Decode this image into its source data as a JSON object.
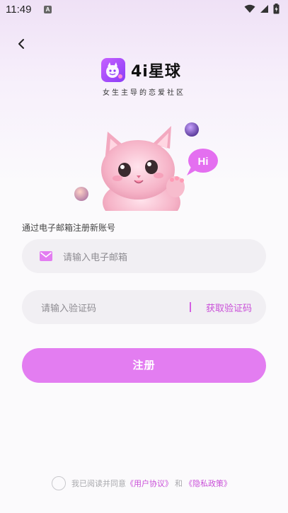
{
  "status_bar": {
    "time": "11:49",
    "app_icon_letter": "A",
    "icons": [
      "wifi-icon",
      "signal-icon",
      "battery-icon"
    ]
  },
  "header": {
    "back_icon": "back-arrow-icon"
  },
  "logo": {
    "text": "4i星球",
    "tagline": "女生主导的恋爱社区"
  },
  "hero": {
    "bubble_text": "Hi"
  },
  "form": {
    "section_label": "通过电子邮箱注册新账号",
    "email_placeholder": "请输入电子邮箱",
    "code_placeholder": "请输入验证码",
    "get_code_label": "获取验证码",
    "submit_label": "注册"
  },
  "agreement": {
    "prefix": "我已阅读并同意",
    "user_agreement": "《用户协议》",
    "and": "和",
    "privacy_policy": "《隐私政策》"
  },
  "colors": {
    "accent": "#e37df1",
    "link": "#c94fd8",
    "input_bg": "#f1eff3"
  }
}
